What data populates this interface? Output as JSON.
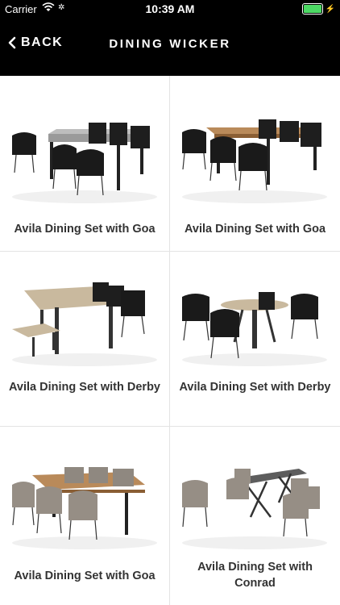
{
  "status_bar": {
    "carrier": "Carrier",
    "time": "10:39 AM"
  },
  "nav": {
    "back_label": "BACK",
    "title": "DINING WICKER"
  },
  "products": [
    {
      "name": "Avila Dining Set with Goa"
    },
    {
      "name": "Avila Dining Set with Goa"
    },
    {
      "name": "Avila Dining Set with Derby"
    },
    {
      "name": "Avila Dining Set with Derby"
    },
    {
      "name": "Avila Dining Set with Goa"
    },
    {
      "name": "Avila Dining Set with Conrad"
    }
  ]
}
